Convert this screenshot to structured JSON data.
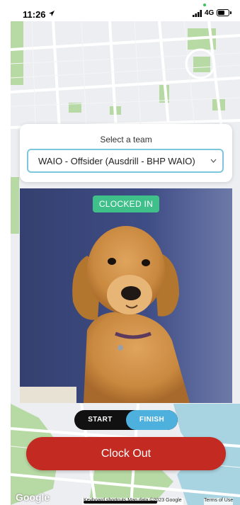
{
  "status_bar": {
    "time": "11:26",
    "network": "4G"
  },
  "team": {
    "label": "Select a team",
    "selected": "WAIO - Offsider (Ausdrill - BHP WAIO)"
  },
  "camera": {
    "badge": "CLOCKED IN"
  },
  "mode_toggle": {
    "start_label": "START",
    "finish_label": "FINISH",
    "active": "FINISH"
  },
  "actions": {
    "clock_out_label": "Clock Out"
  },
  "map": {
    "google_logo": "Google",
    "footer": "Keyboard shortcuts    Map data ©2023 Google",
    "terms": "Terms of Use"
  },
  "colors": {
    "badge": "#3fbf8a",
    "finish_active": "#4eb0dc",
    "clock_out": "#c32a22",
    "select_border": "#7ec6de"
  }
}
